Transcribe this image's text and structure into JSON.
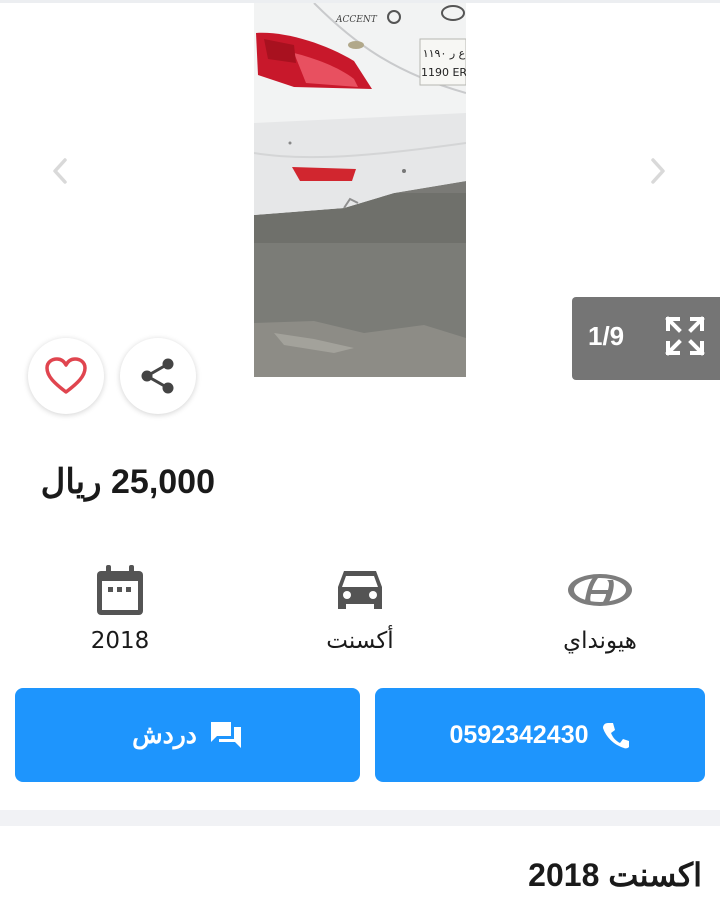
{
  "gallery": {
    "counter": "1/9",
    "plate_top": "۱۱۹۰ ع ر",
    "plate_bottom": "1190 ER",
    "badge_model": "ACCENT"
  },
  "listing": {
    "price": "25,000 ريال",
    "title": "اكسنت 2018"
  },
  "specs": {
    "year": "2018",
    "model": "أكسنت",
    "make": "هيونداي"
  },
  "actions": {
    "phone": "0592342430",
    "chat_label": "دردش"
  },
  "colors": {
    "accent": "#1e95fd",
    "counter_bg": "#757575",
    "heart": "#e0454f"
  },
  "icons": [
    "chevron-left-icon",
    "chevron-right-icon",
    "fullscreen-icon",
    "heart-icon",
    "share-icon",
    "calendar-icon",
    "car-icon",
    "hyundai-logo-icon",
    "chat-icon",
    "phone-icon"
  ]
}
